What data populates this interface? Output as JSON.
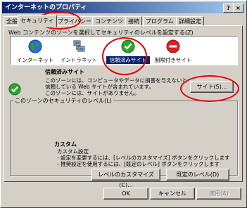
{
  "window": {
    "title": "インターネットのプロパティ",
    "help": "?",
    "close": "×"
  },
  "tabs": [
    "全般",
    "セキュリティ",
    "プライバシー",
    "コンテンツ",
    "接続",
    "プログラム",
    "詳細設定"
  ],
  "security": {
    "instruction": "Web コンテンツのゾーンを選択してセキュリティのレベルを設定する(Z)",
    "zones": [
      {
        "label": "インターネット",
        "icon": "globe-icon"
      },
      {
        "label": "イントラネット",
        "icon": "intranet-icon"
      },
      {
        "label": "信頼済みサイト",
        "icon": "trusted-check-icon"
      },
      {
        "label": "制限付きサイト",
        "icon": "restricted-icon"
      }
    ],
    "zone_title": "信頼済みサイト",
    "zone_desc1": "このゾーンには、コンピュータやデータに損害を与えないと",
    "zone_desc2": "信頼している Web サイトが含まれています。",
    "zone_desc3": "このゾーンには、サイトがありません。",
    "sites_button": "サイト(S)...",
    "group_title": "このゾーンのセキュリティのレベル(L)",
    "level_name": "カスタム",
    "level_desc1": "カスタム設定",
    "level_desc2": "- 設定を変更するには、[レベルのカスタマイズ] ボタンをクリックします",
    "level_desc3": "- 推奨設定を使用するには、[既定のレベル] ボタンをクリックします",
    "customize_button": "レベルのカスタマイズ(C)...",
    "default_button": "既定のレベル(D)"
  },
  "footer": {
    "ok": "OK",
    "cancel": "キャンセル",
    "apply": "適用(A)"
  },
  "colors": {
    "highlight_ring": "#e00000",
    "title_bar": "#0a246a"
  }
}
